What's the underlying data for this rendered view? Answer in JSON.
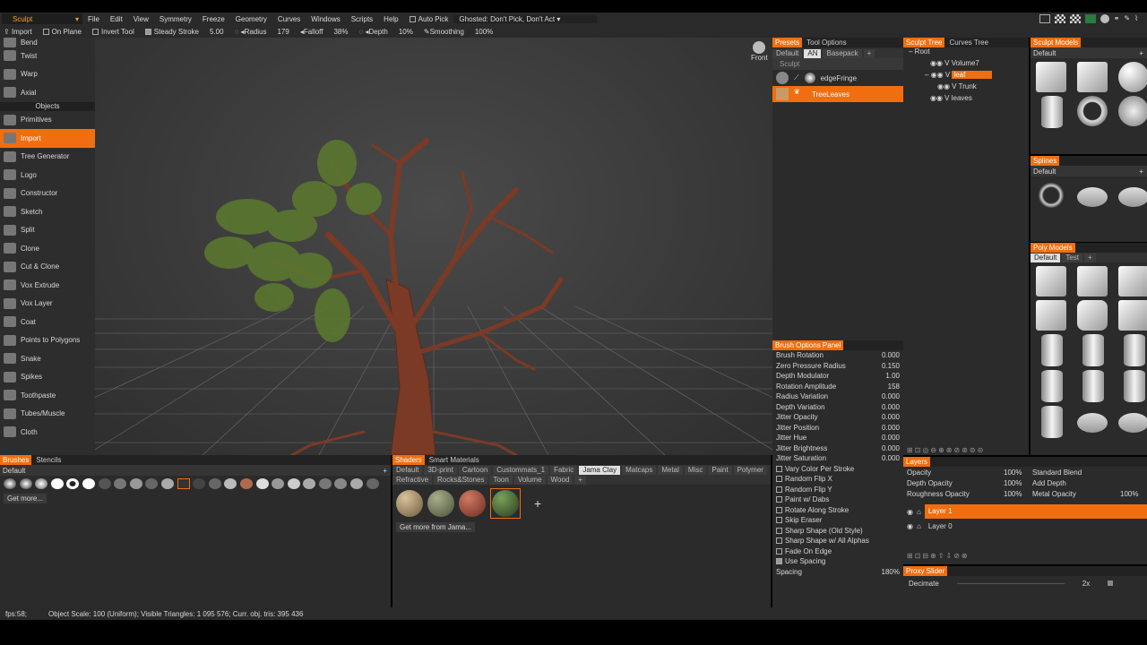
{
  "menubar": {
    "room": "Sculpt",
    "items": [
      "File",
      "Edit",
      "View",
      "Symmetry",
      "Freeze",
      "Geometry",
      "Curves",
      "Windows",
      "Scripts",
      "Help"
    ],
    "auto_pick": "Auto Pick",
    "ghosted": "Ghosted: Don't Pick, Don't Act"
  },
  "toolbar": {
    "import": "Import",
    "on_plane": "On Plane",
    "invert_tool": "Invert Tool",
    "steady_stroke": "Steady Stroke",
    "steady_value": "5.00",
    "radius_label": "Radius",
    "radius_value": "179",
    "falloff_label": "Falloff",
    "falloff_value": "38%",
    "depth_label": "Depth",
    "depth_value": "10%",
    "smoothing_label": "Smoothing",
    "smoothing_value": "100%"
  },
  "left_panel": {
    "top_items": [
      "Bend",
      "Twist",
      "Warp",
      "Axial"
    ],
    "objects_header": "Objects",
    "items": [
      "Primitives",
      "Import",
      "Tree Generator",
      "Logo",
      "Constructor",
      "Sketch",
      "Split",
      "Clone",
      "Cut & Clone",
      "Vox Extrude",
      "Vox Layer",
      "Coat",
      "Points to Polygons",
      "Snake",
      "Spikes",
      "Toothpaste",
      "Tubes/Muscle",
      "Cloth"
    ]
  },
  "viewport": {
    "nav_label": "Front"
  },
  "presets": {
    "tab1": "Presets",
    "tab2": "Tool Options",
    "subtabs": [
      "Default",
      "AN",
      "Basepack"
    ],
    "section": "Sculpt",
    "items": [
      "edgeFringe",
      "TreeLeaves"
    ]
  },
  "sculpt_tree": {
    "tab1": "Sculpt Tree",
    "tab2": "Curves Tree",
    "nodes": [
      {
        "label": "Root"
      },
      {
        "label": "Volume7"
      },
      {
        "label": "leaf"
      },
      {
        "label": "Trunk"
      },
      {
        "label": "leaves"
      }
    ]
  },
  "sculpt_models": {
    "title": "Sculpt Models",
    "preset": "Default"
  },
  "splines": {
    "title": "Splines",
    "preset": "Default"
  },
  "poly_models": {
    "title": "Poly Models",
    "tab1": "Default",
    "tab2": "Test"
  },
  "brush_options": {
    "title": "Brush Options Panel",
    "params": [
      {
        "label": "Brush Rotation",
        "value": "0.000"
      },
      {
        "label": "Zero Pressure Radius",
        "value": "0.150"
      },
      {
        "label": "Depth Modulator",
        "value": "1.00"
      },
      {
        "label": "Rotation Amplitude",
        "value": "158"
      },
      {
        "label": "Radius Variation",
        "value": "0.000"
      },
      {
        "label": "Depth Variation",
        "value": "0.000"
      },
      {
        "label": "Jitter Opacity",
        "value": "0.000"
      },
      {
        "label": "Jitter Position",
        "value": "0.000"
      },
      {
        "label": "Jitter Hue",
        "value": "0.000"
      },
      {
        "label": "Jitter Brightness",
        "value": "0.000"
      },
      {
        "label": "Jitter Saturation",
        "value": "0.000"
      }
    ],
    "checks": [
      {
        "label": "Vary Color Per Stroke"
      },
      {
        "label": "Random Flip X"
      },
      {
        "label": "Random Flip Y"
      },
      {
        "label": "Paint w/ Dabs"
      },
      {
        "label": "Rotate Along Stroke"
      },
      {
        "label": "Skip Eraser"
      },
      {
        "label": "Sharp Shape (Old Style)"
      },
      {
        "label": "Sharp Shape w/ All Alphas"
      },
      {
        "label": "Fade On Edge"
      },
      {
        "label": "Use Spacing",
        "checked": true
      }
    ],
    "spacing_label": "Spacing",
    "spacing_value": "180%"
  },
  "layers": {
    "title": "Layers",
    "opacity": "Opacity",
    "opacity_value": "100%",
    "depth_opacity": "Depth Opacity",
    "depth_opacity_value": "100%",
    "roughness_opacity": "Roughness Opacity",
    "roughness_value": "100%",
    "blend": "Standard Blend",
    "add_depth": "Add Depth",
    "metal_opacity": "Metal Opacity",
    "metal_value": "100%",
    "items": [
      "Layer 1",
      "Layer 0"
    ]
  },
  "proxy": {
    "title": "Proxy Slider",
    "label": "Decimate",
    "value": "2x"
  },
  "brushes": {
    "tab1": "Brushes",
    "tab2": "Stencils",
    "preset": "Default",
    "get_more": "Get more..."
  },
  "shaders": {
    "tab1": "Shaders",
    "tab2": "Smart Materials",
    "cats_row1": [
      "Default",
      "3D-print",
      "Cartoon",
      "Custommats_1",
      "Fabric",
      "Jama Clay",
      "Matcaps",
      "Metal",
      "Misc",
      "Paint",
      "Polymer"
    ],
    "cats_row2": [
      "Refractive",
      "Rocks&Stones",
      "Toon",
      "Volume",
      "Wood"
    ],
    "get_more": "Get more from Jama..."
  },
  "status": {
    "fps": "fps:58;",
    "info": "Object Scale: 100 (Uniform); Visible Triangles: 1 095 576; Curr. obj. tris: 395 436"
  },
  "colors": {
    "accent": "#f06e10",
    "panel": "#2b2b2b",
    "viewport": "#3c3c3c"
  }
}
